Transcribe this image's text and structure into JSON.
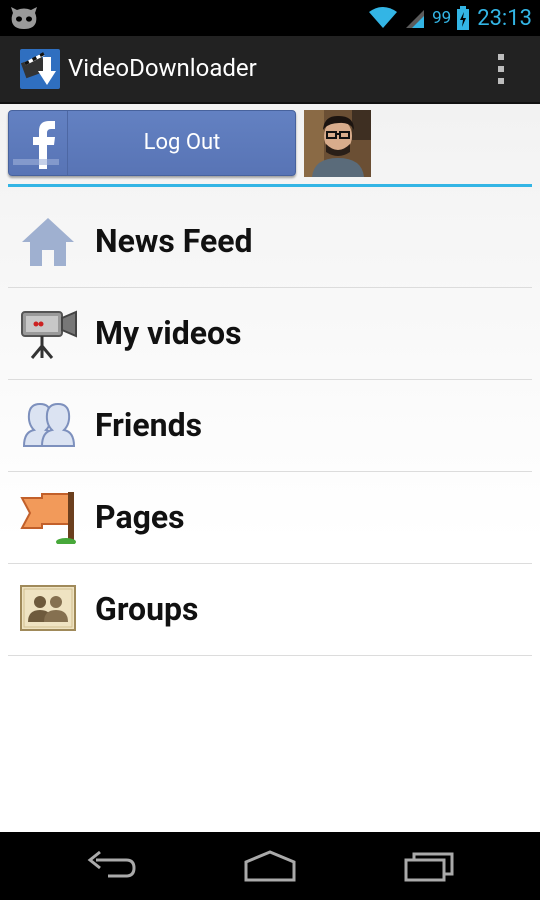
{
  "status": {
    "battery_percent": "99",
    "time": "23:13",
    "accent": "#33b5e5"
  },
  "app": {
    "title": "VideoDownloader",
    "icon": "video-download-icon"
  },
  "facebook": {
    "button_label": "Log Out",
    "brand_color": "#5f7ec1"
  },
  "menu": {
    "items": [
      {
        "label": "News Feed",
        "icon": "home-icon"
      },
      {
        "label": "My videos",
        "icon": "video-camera-icon"
      },
      {
        "label": "Friends",
        "icon": "friends-icon"
      },
      {
        "label": "Pages",
        "icon": "flag-icon"
      },
      {
        "label": "Groups",
        "icon": "groups-icon"
      }
    ]
  }
}
